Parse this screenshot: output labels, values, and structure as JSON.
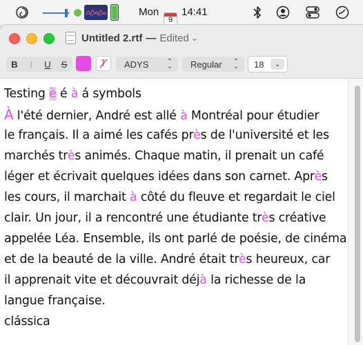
{
  "menubar": {
    "date_label": "Mon",
    "date_badge": "9",
    "time_label": "14:41",
    "icons": [
      "swirl-app-icon",
      "audio-slider-icon",
      "status-dot-icon",
      "waveform-icon",
      "battery-icon",
      "calendar-icon",
      "flag-icon",
      "bluetooth-icon",
      "user-icon",
      "control-center-icon",
      "clock-icon"
    ]
  },
  "window": {
    "title": "Untitled 2.rtf",
    "dash": "—",
    "status": "Edited",
    "chevron": "⌄"
  },
  "toolbar": {
    "bold_label": "B",
    "italic_label": "I",
    "underline_label": "U",
    "strike_label": "S",
    "text_color": "#e94be9",
    "font_family_value": "ADYS",
    "font_style_value": "Regular",
    "font_size_value": "18"
  },
  "document": {
    "lines": [
      [
        {
          "t": "Testing "
        },
        {
          "t": "è",
          "c": "pink sel"
        },
        {
          "t": " é "
        },
        {
          "t": "à",
          "c": "pink"
        },
        {
          "t": " á symbols"
        }
      ],
      [
        {
          "t": "À",
          "c": "bigA"
        },
        {
          "t": " l'été dernier, André est allé "
        },
        {
          "t": "à",
          "c": "pink"
        },
        {
          "t": " Montréal pour étudier"
        }
      ],
      [
        {
          "t": "le français. Il a aimé les cafés pr"
        },
        {
          "t": "è",
          "c": "pink"
        },
        {
          "t": "s de l'université et les"
        }
      ],
      [
        {
          "t": "marchés tr"
        },
        {
          "t": "è",
          "c": "pink"
        },
        {
          "t": "s animés. Chaque matin, il prenait un café"
        }
      ],
      [
        {
          "t": "léger et écrivait quelques idées dans son carnet. Apr"
        },
        {
          "t": "è",
          "c": "pink"
        },
        {
          "t": "s"
        }
      ],
      [
        {
          "t": "les cours, il marchait "
        },
        {
          "t": "à",
          "c": "pink"
        },
        {
          "t": " côté du fleuve et regardait le ciel"
        }
      ],
      [
        {
          "t": "clair. Un jour, il a rencontré une étudiante tr"
        },
        {
          "t": "è",
          "c": "pink"
        },
        {
          "t": "s créative"
        }
      ],
      [
        {
          "t": "appelée Léa. Ensemble, ils ont parlé de poésie, de cinéma"
        }
      ],
      [
        {
          "t": "et de la beauté de la ville. André était tr"
        },
        {
          "t": "è",
          "c": "pink"
        },
        {
          "t": "s heureux, car"
        }
      ],
      [
        {
          "t": "il apprenait vite et découvrait déj"
        },
        {
          "t": "à",
          "c": "pink"
        },
        {
          "t": " la richesse de la"
        }
      ],
      [
        {
          "t": "langue française."
        }
      ],
      [
        {
          "t": "clássica"
        }
      ]
    ]
  }
}
